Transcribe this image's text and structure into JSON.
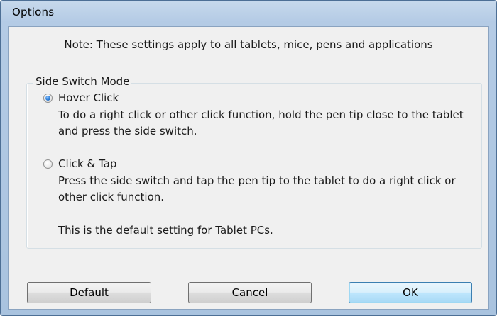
{
  "window": {
    "title": "Options"
  },
  "note": "Note: These settings apply to all tablets, mice, pens and applications",
  "side_switch_group": {
    "legend": "Side Switch Mode",
    "options": [
      {
        "label": "Hover Click",
        "checked": true,
        "description": "To do a right click or other click function, hold the pen tip close to the tablet and press the side switch."
      },
      {
        "label": "Click & Tap",
        "checked": false,
        "description": "Press the side switch and tap the pen tip to the tablet to do a right click or other click function.",
        "extra_note": "This is the default setting for Tablet PCs."
      }
    ]
  },
  "buttons": {
    "default_label": "Default",
    "cancel_label": "Cancel",
    "ok_label": "OK"
  },
  "colors": {
    "title_bar": "#b4cbe5",
    "dialog_body": "#f0f0f0",
    "focused_button_border": "#3c7fb1"
  }
}
